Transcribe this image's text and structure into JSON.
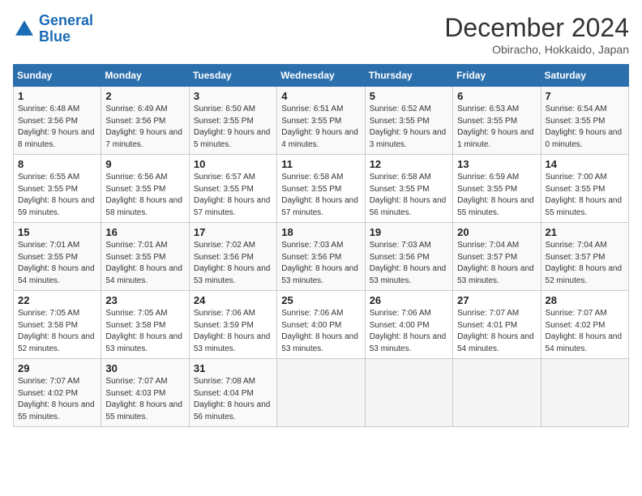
{
  "header": {
    "logo_line1": "General",
    "logo_line2": "Blue",
    "month": "December 2024",
    "location": "Obiracho, Hokkaido, Japan"
  },
  "weekdays": [
    "Sunday",
    "Monday",
    "Tuesday",
    "Wednesday",
    "Thursday",
    "Friday",
    "Saturday"
  ],
  "weeks": [
    [
      {
        "day": "1",
        "rise": "6:48 AM",
        "set": "3:56 PM",
        "hours": "9 hours and 8 minutes."
      },
      {
        "day": "2",
        "rise": "6:49 AM",
        "set": "3:56 PM",
        "hours": "9 hours and 7 minutes."
      },
      {
        "day": "3",
        "rise": "6:50 AM",
        "set": "3:55 PM",
        "hours": "9 hours and 5 minutes."
      },
      {
        "day": "4",
        "rise": "6:51 AM",
        "set": "3:55 PM",
        "hours": "9 hours and 4 minutes."
      },
      {
        "day": "5",
        "rise": "6:52 AM",
        "set": "3:55 PM",
        "hours": "9 hours and 3 minutes."
      },
      {
        "day": "6",
        "rise": "6:53 AM",
        "set": "3:55 PM",
        "hours": "9 hours and 1 minute."
      },
      {
        "day": "7",
        "rise": "6:54 AM",
        "set": "3:55 PM",
        "hours": "9 hours and 0 minutes."
      }
    ],
    [
      {
        "day": "8",
        "rise": "6:55 AM",
        "set": "3:55 PM",
        "hours": "8 hours and 59 minutes."
      },
      {
        "day": "9",
        "rise": "6:56 AM",
        "set": "3:55 PM",
        "hours": "8 hours and 58 minutes."
      },
      {
        "day": "10",
        "rise": "6:57 AM",
        "set": "3:55 PM",
        "hours": "8 hours and 57 minutes."
      },
      {
        "day": "11",
        "rise": "6:58 AM",
        "set": "3:55 PM",
        "hours": "8 hours and 57 minutes."
      },
      {
        "day": "12",
        "rise": "6:58 AM",
        "set": "3:55 PM",
        "hours": "8 hours and 56 minutes."
      },
      {
        "day": "13",
        "rise": "6:59 AM",
        "set": "3:55 PM",
        "hours": "8 hours and 55 minutes."
      },
      {
        "day": "14",
        "rise": "7:00 AM",
        "set": "3:55 PM",
        "hours": "8 hours and 55 minutes."
      }
    ],
    [
      {
        "day": "15",
        "rise": "7:01 AM",
        "set": "3:55 PM",
        "hours": "8 hours and 54 minutes."
      },
      {
        "day": "16",
        "rise": "7:01 AM",
        "set": "3:55 PM",
        "hours": "8 hours and 54 minutes."
      },
      {
        "day": "17",
        "rise": "7:02 AM",
        "set": "3:56 PM",
        "hours": "8 hours and 53 minutes."
      },
      {
        "day": "18",
        "rise": "7:03 AM",
        "set": "3:56 PM",
        "hours": "8 hours and 53 minutes."
      },
      {
        "day": "19",
        "rise": "7:03 AM",
        "set": "3:56 PM",
        "hours": "8 hours and 53 minutes."
      },
      {
        "day": "20",
        "rise": "7:04 AM",
        "set": "3:57 PM",
        "hours": "8 hours and 53 minutes."
      },
      {
        "day": "21",
        "rise": "7:04 AM",
        "set": "3:57 PM",
        "hours": "8 hours and 52 minutes."
      }
    ],
    [
      {
        "day": "22",
        "rise": "7:05 AM",
        "set": "3:58 PM",
        "hours": "8 hours and 52 minutes."
      },
      {
        "day": "23",
        "rise": "7:05 AM",
        "set": "3:58 PM",
        "hours": "8 hours and 53 minutes."
      },
      {
        "day": "24",
        "rise": "7:06 AM",
        "set": "3:59 PM",
        "hours": "8 hours and 53 minutes."
      },
      {
        "day": "25",
        "rise": "7:06 AM",
        "set": "4:00 PM",
        "hours": "8 hours and 53 minutes."
      },
      {
        "day": "26",
        "rise": "7:06 AM",
        "set": "4:00 PM",
        "hours": "8 hours and 53 minutes."
      },
      {
        "day": "27",
        "rise": "7:07 AM",
        "set": "4:01 PM",
        "hours": "8 hours and 54 minutes."
      },
      {
        "day": "28",
        "rise": "7:07 AM",
        "set": "4:02 PM",
        "hours": "8 hours and 54 minutes."
      }
    ],
    [
      {
        "day": "29",
        "rise": "7:07 AM",
        "set": "4:02 PM",
        "hours": "8 hours and 55 minutes."
      },
      {
        "day": "30",
        "rise": "7:07 AM",
        "set": "4:03 PM",
        "hours": "8 hours and 55 minutes."
      },
      {
        "day": "31",
        "rise": "7:08 AM",
        "set": "4:04 PM",
        "hours": "8 hours and 56 minutes."
      },
      null,
      null,
      null,
      null
    ]
  ]
}
